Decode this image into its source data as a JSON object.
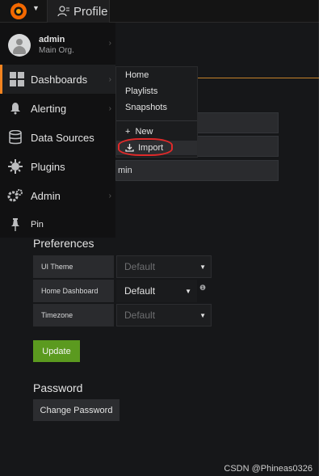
{
  "topbar": {
    "tab_label": "Profile"
  },
  "user": {
    "name": "admin",
    "org": "Main Org."
  },
  "sidemenu": {
    "items": [
      {
        "label": "Dashboards",
        "icon": "dashboards-grid-icon",
        "active": true
      },
      {
        "label": "Alerting",
        "icon": "bell-icon"
      },
      {
        "label": "Data Sources",
        "icon": "database-icon"
      },
      {
        "label": "Plugins",
        "icon": "plug-icon"
      },
      {
        "label": "Admin",
        "icon": "cogs-icon"
      },
      {
        "label": "Pin",
        "icon": "pin-icon"
      }
    ]
  },
  "submenu": {
    "items": [
      "Home",
      "Playlists",
      "Snapshots"
    ],
    "new_label": "New",
    "import_label": "Import"
  },
  "partial_field_text": "min",
  "preferences": {
    "title": "Preferences",
    "rows": [
      {
        "label": "UI Theme",
        "value": "Default"
      },
      {
        "label": "Home Dashboard",
        "value": "Default"
      },
      {
        "label": "Timezone",
        "value": "Default"
      }
    ],
    "update_label": "Update"
  },
  "password": {
    "title": "Password",
    "button_label": "Change Password"
  },
  "watermark": "CSDN @Phineas0326",
  "colors": {
    "accent": "#f48420",
    "update_button": "#5b9a1f",
    "annotation": "#e02a2a"
  }
}
